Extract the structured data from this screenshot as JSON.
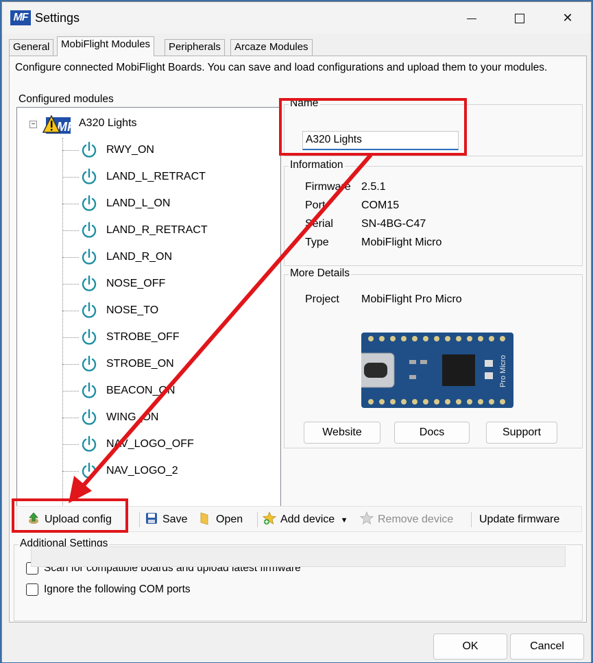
{
  "window": {
    "title": "Settings",
    "logo_text": "MF"
  },
  "tabs": [
    {
      "label": "General"
    },
    {
      "label": "MobiFlight Modules"
    },
    {
      "label": "Peripherals"
    },
    {
      "label": "Arcaze Modules"
    }
  ],
  "intro": "Configure connected MobiFlight Boards. You can save and load configurations and upload them to your modules.",
  "configured_modules": {
    "label": "Configured modules",
    "root": "A320 Lights",
    "items": [
      "RWY_ON",
      "LAND_L_RETRACT",
      "LAND_L_ON",
      "LAND_R_RETRACT",
      "LAND_R_ON",
      "NOSE_OFF",
      "NOSE_TO",
      "STROBE_OFF",
      "STROBE_ON",
      "BEACON_ON",
      "WING_ON",
      "NAV_LOGO_OFF",
      "NAV_LOGO_2"
    ]
  },
  "name_group": {
    "label": "Name",
    "value": "A320 Lights"
  },
  "information": {
    "label": "Information",
    "rows": [
      {
        "key": "Firmware",
        "value": "2.5.1"
      },
      {
        "key": "Port",
        "value": "COM15"
      },
      {
        "key": "Serial",
        "value": "SN-4BG-C47"
      },
      {
        "key": "Type",
        "value": "MobiFlight Micro"
      }
    ]
  },
  "more_details": {
    "label": "More Details",
    "project_key": "Project",
    "project_value": "MobiFlight Pro Micro",
    "board_text": "Pro Micro",
    "buttons": {
      "website": "Website",
      "docs": "Docs",
      "support": "Support"
    }
  },
  "toolbar": {
    "upload": "Upload config",
    "save": "Save",
    "open": "Open",
    "add_device": "Add device",
    "remove_device": "Remove device",
    "update_firmware": "Update firmware"
  },
  "additional_settings": {
    "label": "Additional Settings",
    "scan": "Scan for compatible boards and upload latest firmware",
    "ignore": "Ignore the following COM ports"
  },
  "footer": {
    "ok": "OK",
    "cancel": "Cancel"
  },
  "colors": {
    "highlight": "#e0161b",
    "power_icon": "#1e8fa3",
    "accent": "#2a6fbe"
  }
}
